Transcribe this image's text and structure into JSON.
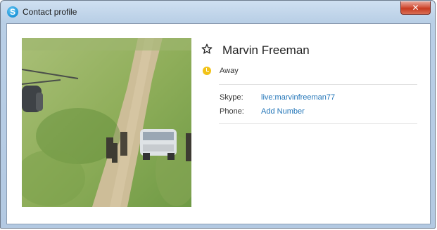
{
  "window": {
    "title": "Contact profile",
    "close_glyph": "✕",
    "app_icon": "skype-icon",
    "app_icon_glyph": "S"
  },
  "profile": {
    "name": "Marvin Freeman",
    "favorite_icon": "star-outline-icon",
    "status_icon": "away-clock-icon",
    "status": "Away",
    "fields": {
      "skype_label": "Skype:",
      "skype_value": "live:marvinfreeman77",
      "phone_label": "Phone:",
      "phone_value": "Add Number"
    }
  },
  "colors": {
    "link": "#2275b8",
    "away": "#f2c318",
    "titlebar": "#b9cfe6"
  }
}
